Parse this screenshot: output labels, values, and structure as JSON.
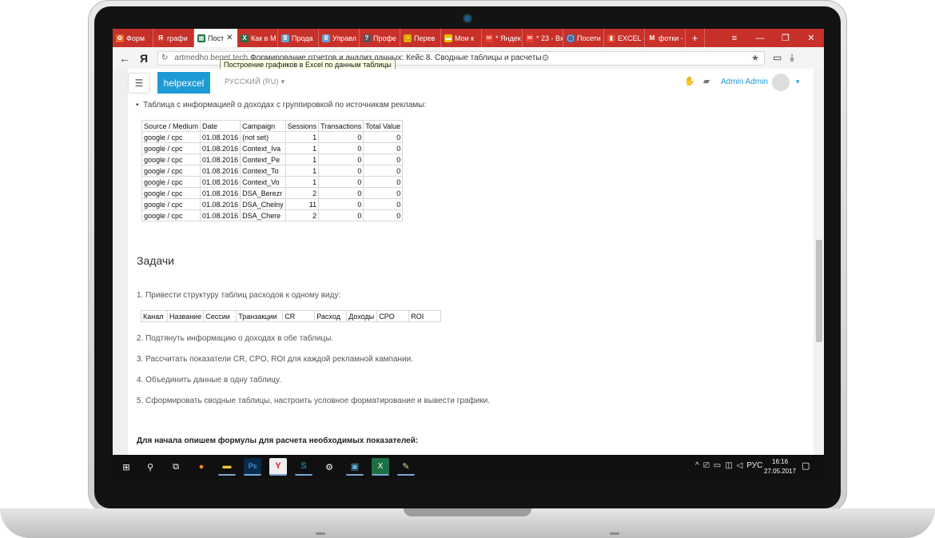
{
  "browser": {
    "tabs": [
      {
        "label": "Форм",
        "color": "#e8652c",
        "glyph": "✿"
      },
      {
        "label": "графи",
        "color": "#d33a2c",
        "glyph": "Я"
      },
      {
        "label": "Пост",
        "color": "#1d7044",
        "glyph": "▦",
        "active": true
      },
      {
        "label": "Как в М",
        "color": "#1d7044",
        "glyph": "X"
      },
      {
        "label": "Прода",
        "color": "#6aa0c9",
        "glyph": "8"
      },
      {
        "label": "Управл",
        "color": "#6aa0c9",
        "glyph": "8"
      },
      {
        "label": "Профе",
        "color": "#555555",
        "glyph": "?"
      },
      {
        "label": "Перев",
        "color": "#e0a800",
        "glyph": "◔"
      },
      {
        "label": "Мои к",
        "color": "#e0c200",
        "glyph": "▬"
      },
      {
        "label": "* Яндек",
        "color": "#e83a2c",
        "glyph": "✉"
      },
      {
        "label": "* 23 - Вх",
        "color": "#e83a2c",
        "glyph": "✉"
      },
      {
        "label": "Посети",
        "color": "#3b6ea5",
        "glyph": "◯"
      },
      {
        "label": "EXCEL -",
        "color": "#e84a2c",
        "glyph": "▮"
      },
      {
        "label": "фотки -",
        "color": "#d93025",
        "glyph": "M"
      }
    ],
    "new_tab": "+",
    "controls": {
      "menu": "≡",
      "minimize": "—",
      "restore": "❐",
      "close": "✕"
    },
    "url_host": "artmedho.beget.tech",
    "url_title": "Формирование отчетов и анализ данных: Кейс 8. Сводные таблицы и расчеты",
    "tooltip": "Построение графиков в Excel по данным таблицы",
    "back": "←",
    "ya": "Я",
    "reload": "↻"
  },
  "site": {
    "brand": "helpexcel",
    "lang": "РУССКИЙ (RU)",
    "user": "Admin Admin",
    "menu_glyph": "☰"
  },
  "content": {
    "bullet_text": "Таблица с информацией о доходах с группировкой по источникам рекламы:",
    "income_headers": [
      "Source / Medium",
      "Date",
      "Campaign",
      "Sessions",
      "Transactions",
      "Total Value"
    ],
    "income_rows": [
      [
        "google / cpc",
        "01.08.2016",
        "(not set)",
        "1",
        "0",
        "0"
      ],
      [
        "google / cpc",
        "01.08.2016",
        "Context_Iva",
        "1",
        "0",
        "0"
      ],
      [
        "google / cpc",
        "01.08.2016",
        "Context_Pe",
        "1",
        "0",
        "0"
      ],
      [
        "google / cpc",
        "01.08.2016",
        "Context_To",
        "1",
        "0",
        "0"
      ],
      [
        "google / cpc",
        "01.08.2016",
        "Context_Vo",
        "1",
        "0",
        "0"
      ],
      [
        "google / cpc",
        "01.08.2016",
        "DSA_Berezr",
        "2",
        "0",
        "0"
      ],
      [
        "google / cpc",
        "01.08.2016",
        "DSA_Chelny",
        "11",
        "0",
        "0"
      ],
      [
        "google / cpc",
        "01.08.2016",
        "DSA_Chere",
        "2",
        "0",
        "0"
      ]
    ],
    "section_title": "Задачи",
    "task1": "1. Привести структуру таблиц расходов к одному виду:",
    "struct_headers": [
      "Канал",
      "Название",
      "Сессии",
      "Транзакции",
      "CR",
      "Расход",
      "Доходы",
      "CPO",
      "ROI"
    ],
    "task2": "2. Подтянуть информацию о доходах в обе таблицы.",
    "task3": "3. Рассчитать показатели CR, CPO, ROI для каждой рекламной кампании.",
    "task4": "4. Объединить данные в одну таблицу.",
    "task5": "5. Сформировать сводные таблицы, настроить условное форматирование и вывести графики.",
    "bold_line": "Для начала опишем формулы для расчета необходимых показателей:"
  },
  "taskbar": {
    "lang": "РУС",
    "time": "16:16",
    "date": "27.05.2017"
  }
}
